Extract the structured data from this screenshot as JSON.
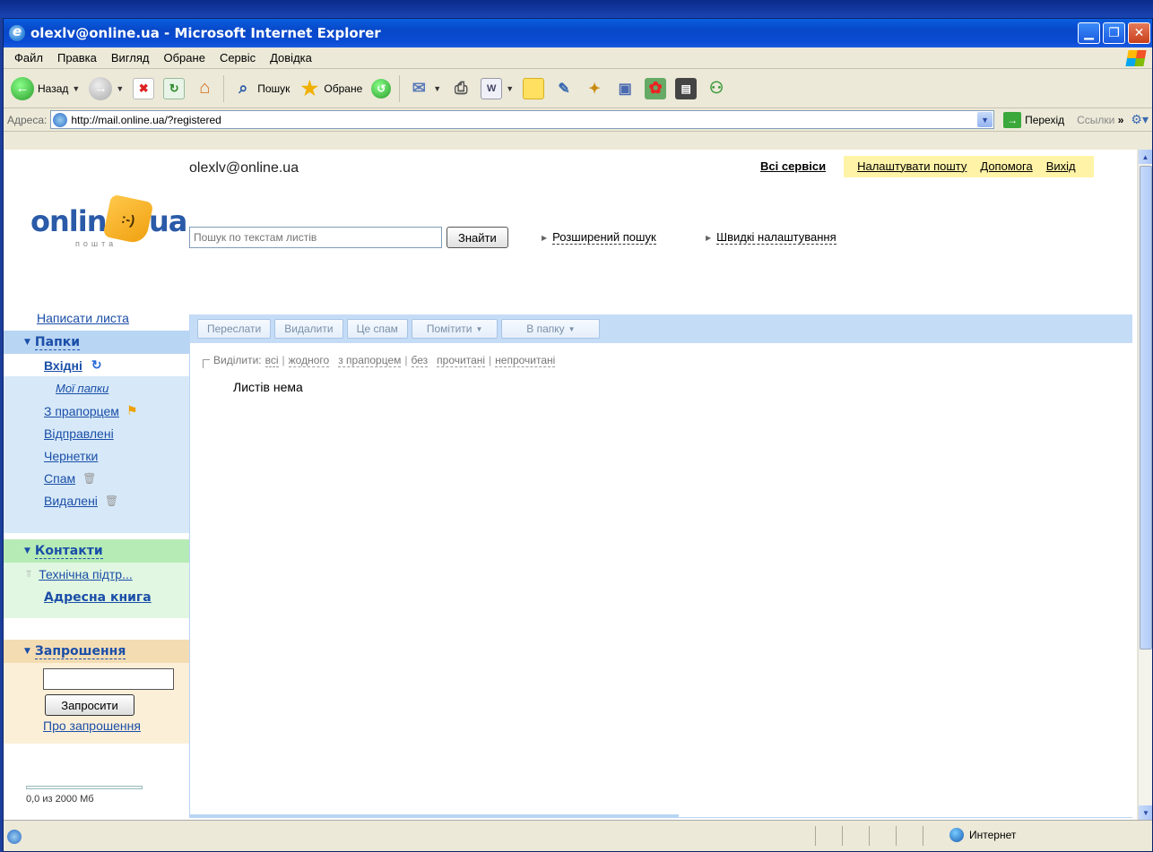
{
  "window": {
    "title": "olexlv@online.ua - Microsoft Internet Explorer",
    "controls": [
      "minimize",
      "restore",
      "close"
    ]
  },
  "menu": [
    "Файл",
    "Правка",
    "Вигляд",
    "Обране",
    "Сервіс",
    "Довідка"
  ],
  "toolbar": {
    "back_label": "Назад",
    "search_label": "Пошук",
    "favorites_label": "Обране"
  },
  "address": {
    "label": "Адреса:",
    "url": "http://mail.online.ua/?registered",
    "go_label": "Перехід",
    "links_label": "Ссылки"
  },
  "page": {
    "logo": {
      "word": "online",
      "suffix": "ua",
      "smile": ":-)",
      "sub": "пошта"
    },
    "account_email": "olexlv@online.ua",
    "top_links": {
      "all_services": "Всі сервіси",
      "settings": "Налаштувати пошту",
      "help": "Допомога",
      "logout": "Вихід"
    },
    "search": {
      "placeholder": "Пошук по текстам листів",
      "button": "Знайти",
      "advanced": "Розширений пошук",
      "quick_settings": "Швидкі налаштування"
    },
    "compose": "Написати листа",
    "folders": {
      "header": "Папки",
      "inbox": "Вхідні",
      "my_folders": "Мої папки",
      "items": [
        {
          "label": "З прапорцем",
          "icon": "flag-icon"
        },
        {
          "label": "Відправлені"
        },
        {
          "label": "Чернетки"
        },
        {
          "label": "Спам",
          "icon": "trash-icon"
        },
        {
          "label": "Видалені",
          "icon": "trash-icon"
        }
      ]
    },
    "contacts": {
      "header": "Контакти",
      "support": "Технічна підтр...",
      "address_book": "Адресна книга"
    },
    "invites": {
      "header": "Запрошення",
      "button": "Запросити",
      "about": "Про запрошення"
    },
    "quota": {
      "text": "0,0 из 2000 Мб",
      "used_fraction": 0.0
    },
    "actions": {
      "forward": "Переслати",
      "delete": "Видалити",
      "spam": "Це спам",
      "mark": "Помітити",
      "to_folder": "В папку"
    },
    "select": {
      "label": "Виділити:",
      "all": "всі",
      "none": "жодного",
      "flagged": "з прапорцем",
      "without": "без",
      "read": "прочитані",
      "unread": "непрочитані"
    },
    "empty_message": "Листів нема"
  },
  "status": {
    "zone": "Интернет"
  }
}
